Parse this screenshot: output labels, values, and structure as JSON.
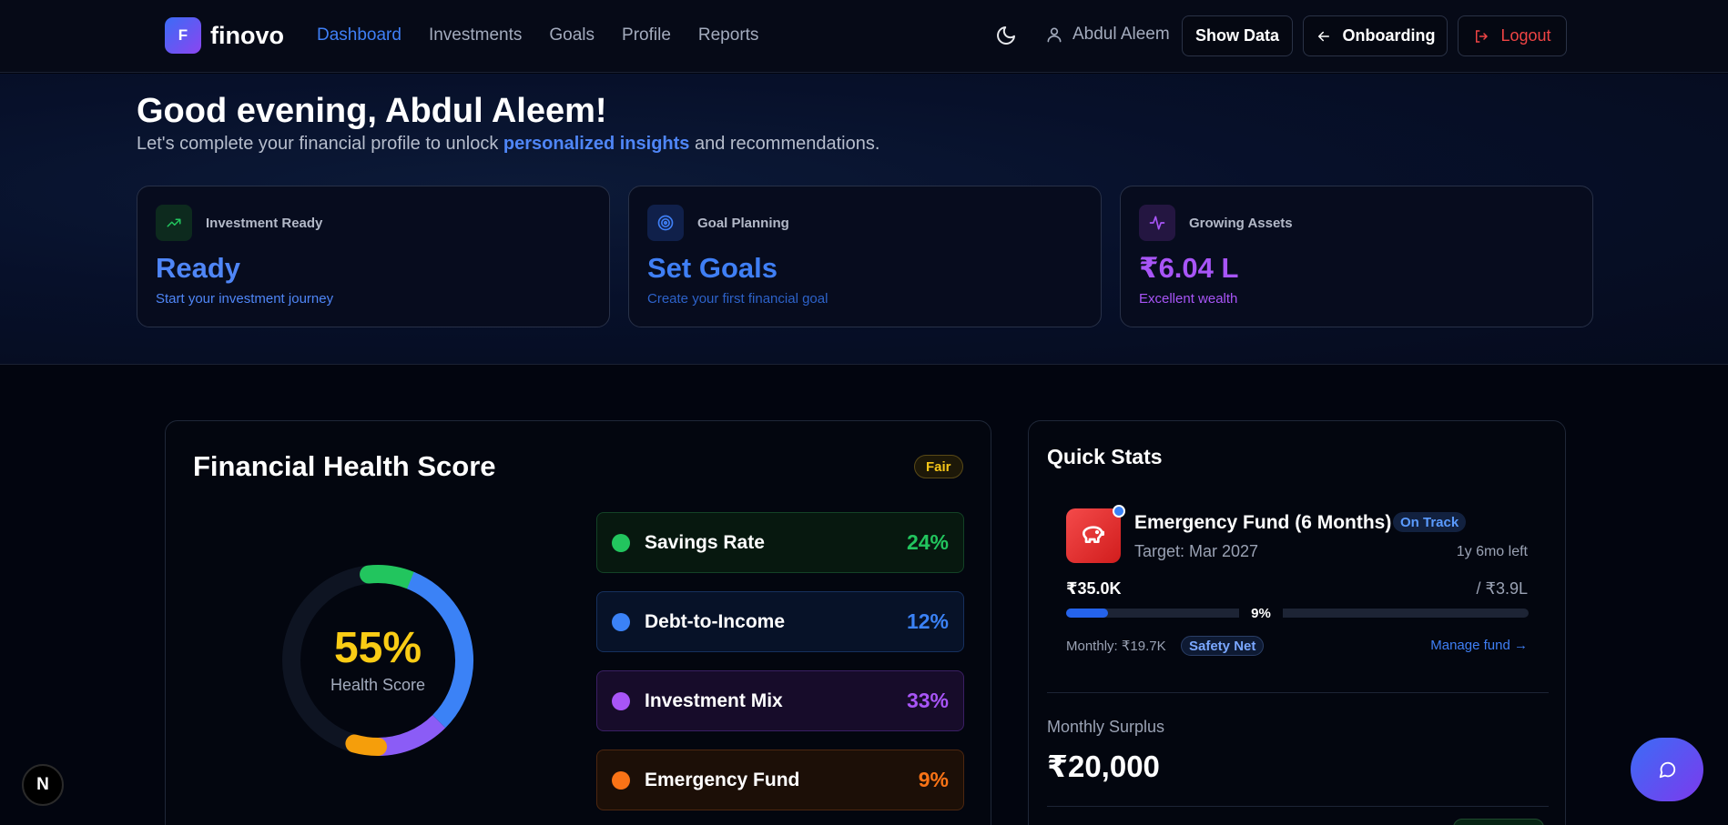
{
  "brand": {
    "mark": "F",
    "name": "finovo"
  },
  "nav": {
    "items": [
      {
        "label": "Dashboard",
        "active": true
      },
      {
        "label": "Investments",
        "active": false
      },
      {
        "label": "Goals",
        "active": false
      },
      {
        "label": "Profile",
        "active": false
      },
      {
        "label": "Reports",
        "active": false
      }
    ]
  },
  "header": {
    "theme_icon": "moon-icon",
    "user_icon": "user-icon",
    "user_name": "Abdul Aleem",
    "show_data_label": "Show Data",
    "onboarding_label": "Onboarding",
    "logout_label": "Logout"
  },
  "hero": {
    "greeting": "Good evening, Abdul Aleem!",
    "subline_before": "Let's complete your financial profile to unlock ",
    "subline_highlight": "personalized insights",
    "subline_after": " and recommendations.",
    "cards": [
      {
        "icon": "trending-up-icon",
        "label": "Investment Ready",
        "value": "Ready",
        "desc": "Start your investment journey",
        "color": "#4f86f7",
        "desc_color": "#4f86f7",
        "icon_color": "#22c55e",
        "icon_bg": "#0d2a1e"
      },
      {
        "icon": "target-icon",
        "label": "Goal Planning",
        "value": "Set Goals",
        "desc": "Create your first financial goal",
        "color": "#3f7ff5",
        "desc_color": "#2d62c9",
        "icon_color": "#3f7ff5",
        "icon_bg": "#10204a"
      },
      {
        "icon": "activity-icon",
        "label": "Growing Assets",
        "value": "₹6.04 L",
        "desc": "Excellent wealth",
        "color": "#a855f7",
        "desc_color": "#a855f7",
        "icon_color": "#a855f7",
        "icon_bg": "#241641"
      }
    ]
  },
  "health": {
    "title": "Financial Health Score",
    "badge": "Fair",
    "score_text": "55%",
    "score_label": "Health Score",
    "score_value": 55,
    "metrics": [
      {
        "name": "Savings Rate",
        "pct": "24%",
        "color": "#22c55e",
        "bg": "#07180f",
        "border": "#134226"
      },
      {
        "name": "Debt-to-Income",
        "pct": "12%",
        "color": "#3b82f6",
        "bg": "#071228",
        "border": "#16305e"
      },
      {
        "name": "Investment Mix",
        "pct": "33%",
        "color": "#a855f7",
        "bg": "#170c2a",
        "border": "#3a1f63"
      },
      {
        "name": "Emergency Fund",
        "pct": "9%",
        "color": "#f97316",
        "bg": "#1c0f07",
        "border": "#4d2710"
      }
    ]
  },
  "quick_stats": {
    "title": "Quick Stats",
    "fund": {
      "icon": "piggy-bank-icon",
      "title": "Emergency Fund (6 Months)",
      "status": "On Track",
      "target": "Target: Mar 2027",
      "time_left": "1y 6mo left",
      "saved": "₹35.0K",
      "goal": "/ ₹3.9L",
      "progress_text": "9%",
      "progress": 0.09,
      "monthly": "Monthly: ₹19.7K",
      "tag": "Safety Net",
      "manage": "Manage fund →"
    },
    "surplus": {
      "label": "Monthly Surplus",
      "value": "₹20,000"
    }
  },
  "chat": {
    "icon": "chat-bubble-icon"
  },
  "dev_badge": {
    "label": "N"
  }
}
